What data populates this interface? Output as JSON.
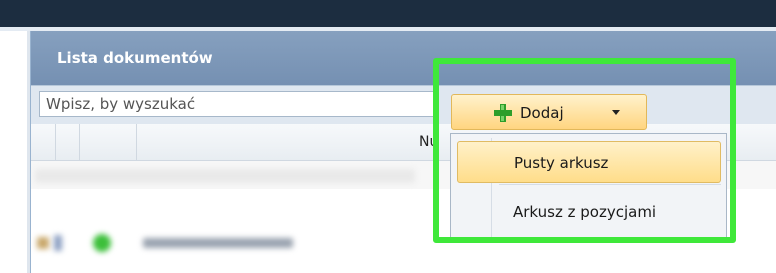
{
  "panel": {
    "title": "Lista dokumentów"
  },
  "search": {
    "placeholder": "Wpisz, by wyszukać"
  },
  "grid": {
    "column_header": "Nu"
  },
  "toolbar": {
    "add_label": "Dodaj",
    "add_icon": "plus-icon",
    "dropdown_icon": "chevron-down-icon"
  },
  "dropdown": {
    "items": [
      {
        "label": "Pusty arkusz",
        "state": "hovered"
      },
      {
        "label": "Arkusz z pozycjami",
        "state": "normal"
      }
    ]
  },
  "colors": {
    "topbar": "#1c2d40",
    "panel_header": "#7f9abb",
    "add_button": "#ffd580",
    "highlight_border": "#3fe83a"
  }
}
